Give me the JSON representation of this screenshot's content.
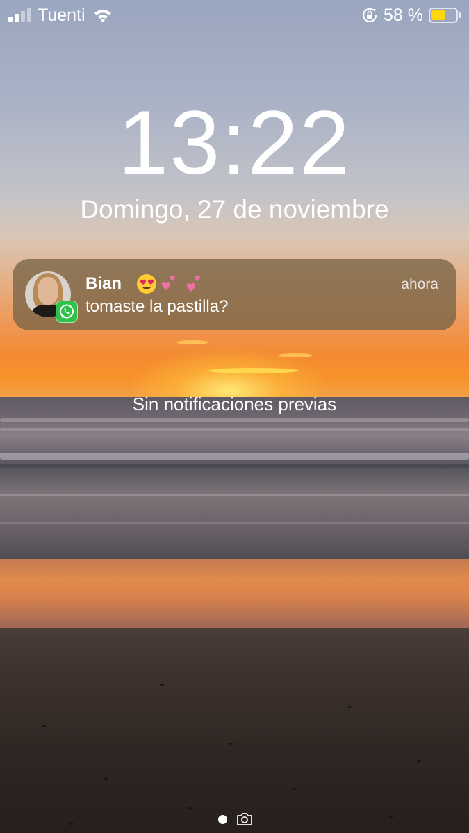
{
  "status_bar": {
    "carrier": "Tuenti",
    "signal_bars_filled": 2,
    "signal_bars_total": 4,
    "battery_percent_label": "58 %",
    "battery_level": 0.58,
    "icons": [
      "signal-icon",
      "wifi-icon",
      "rotation-lock-icon",
      "battery-icon"
    ],
    "battery_color": "#FFD60A"
  },
  "lock_screen": {
    "time": "13:22",
    "date": "Domingo, 27 de noviembre"
  },
  "notification": {
    "app_icon": "whatsapp-icon",
    "app_color": "#2FC24A",
    "sender": "Bian",
    "sender_emoji": [
      "smiling-face-with-heart-eyes",
      "two-hearts",
      "two-hearts"
    ],
    "time": "ahora",
    "message": "tomaste la pastilla?"
  },
  "notification_center": {
    "empty_label": "Sin notificaciones previas"
  },
  "bottom_controls": {
    "icons": [
      "page-indicator-dot",
      "camera-icon"
    ]
  }
}
